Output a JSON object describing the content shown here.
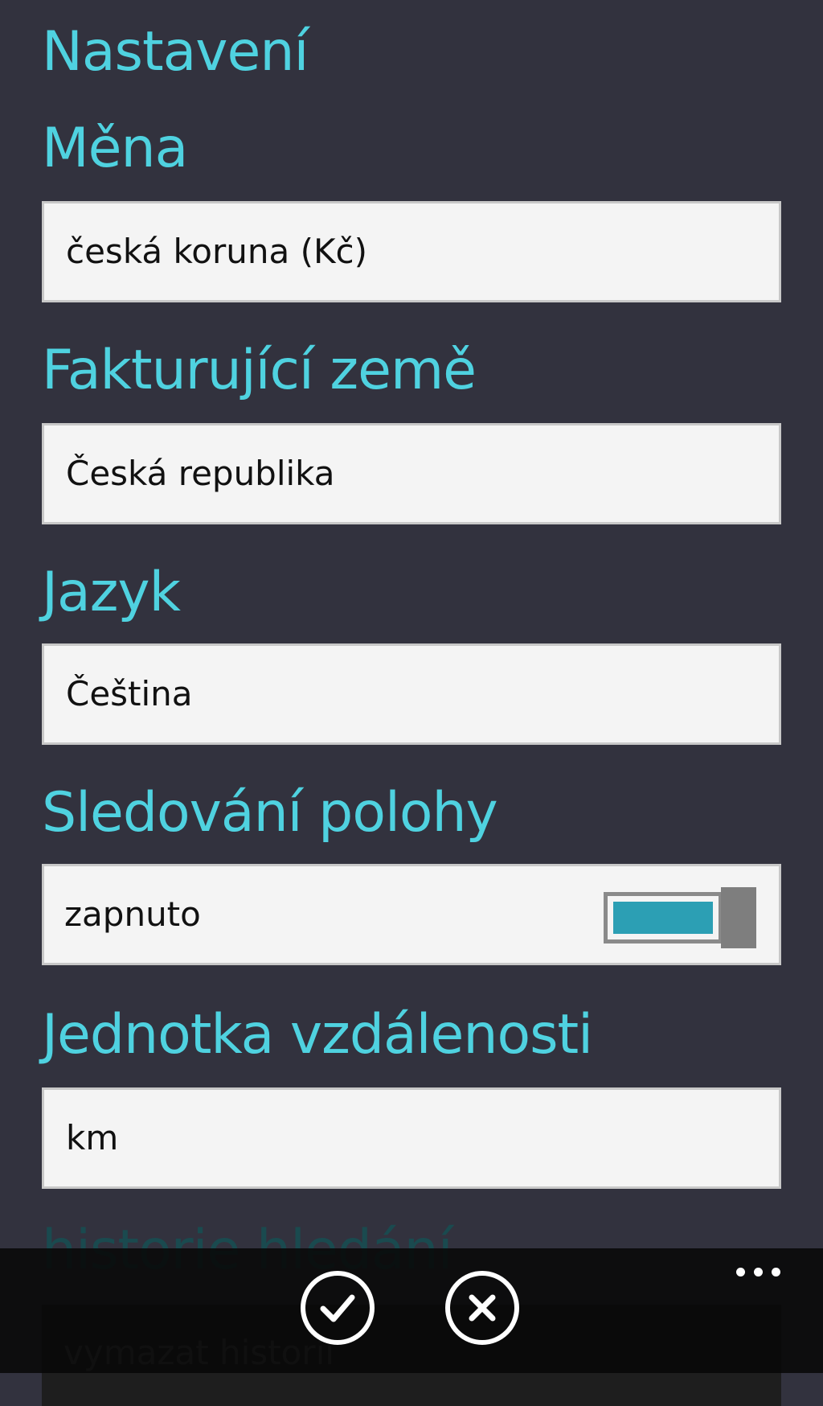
{
  "page": {
    "title": "Nastavení"
  },
  "settings": {
    "currency": {
      "label": "Měna",
      "value": "česká koruna (Kč)"
    },
    "billing_country": {
      "label": "Fakturující země",
      "value": "Česká republika"
    },
    "language": {
      "label": "Jazyk",
      "value": "Čeština"
    },
    "location_tracking": {
      "label": "Sledování polohy",
      "value": "zapnuto",
      "enabled": true
    },
    "distance_unit": {
      "label": "Jednotka vzdálenosti",
      "value": "km"
    },
    "search_history": {
      "label": "historie hledání",
      "value": "vymazat historii"
    }
  },
  "app_bar": {
    "buttons": [
      {
        "icon": "checkmark-icon"
      },
      {
        "icon": "close-icon"
      }
    ],
    "more_icon": "more-dots-icon"
  },
  "colors": {
    "background": "#32323e",
    "accent": "#4fd2e0",
    "toggle_on": "#2c9fb4",
    "field_background": "#f4f4f4"
  }
}
